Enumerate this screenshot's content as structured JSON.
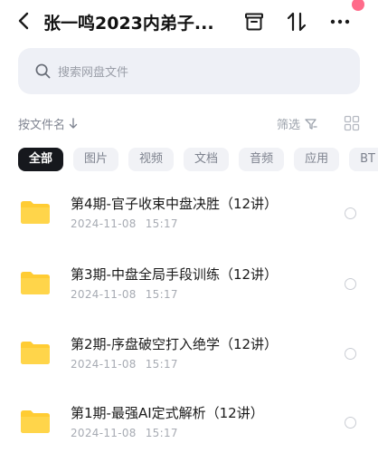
{
  "header": {
    "title": "张一鸣2023内弟子...",
    "back_icon": "chevron-left-icon",
    "icons": [
      "archive-box-icon",
      "sort-arrows-icon",
      "more-dots-icon"
    ]
  },
  "search": {
    "placeholder": "搜索网盘文件"
  },
  "sortbar": {
    "sort_label": "按文件名",
    "filter_label": "筛选"
  },
  "tabs": [
    "全部",
    "图片",
    "视频",
    "文档",
    "音频",
    "应用",
    "BT"
  ],
  "files": [
    {
      "name": "第4期-官子收束中盘决胜（12讲）",
      "date": "2024-11-08",
      "time": "15:17"
    },
    {
      "name": "第3期-中盘全局手段训练（12讲）",
      "date": "2024-11-08",
      "time": "15:17"
    },
    {
      "name": "第2期-序盘破空打入绝学（12讲）",
      "date": "2024-11-08",
      "time": "15:17"
    },
    {
      "name": "第1期-最强AI定式解析（12讲）",
      "date": "2024-11-08",
      "time": "15:17"
    }
  ],
  "colors": {
    "folder": "#ffcc33",
    "active_tab_bg": "#16181d",
    "badge": "#ff6b8a"
  }
}
